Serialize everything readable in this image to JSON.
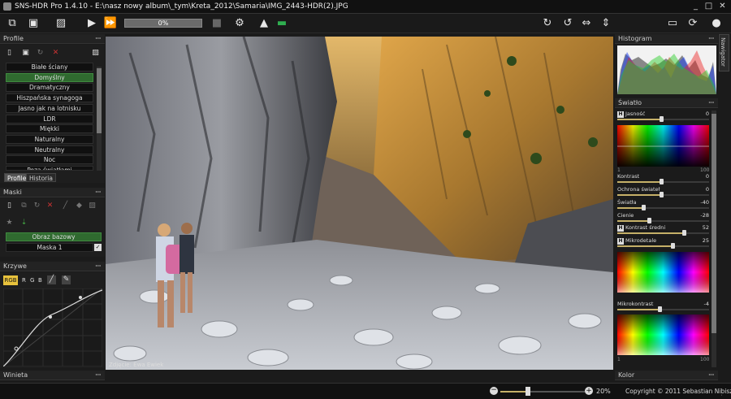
{
  "window": {
    "title": "SNS-HDR Pro 1.4.10 - E:\\nasz nowy album\\_tym\\Kreta_2012\\Samaria\\IMG_2443-HDR(2).JPG"
  },
  "toolbar": {
    "progress": "0%"
  },
  "profile": {
    "title": "Profile",
    "presets": [
      "Białe ściany",
      "Domyślny",
      "Dramatyczny",
      "Hiszpańska synagoga",
      "Jasno jak na lotnisku",
      "LDR",
      "Miękki",
      "Naturalny",
      "Neutralny",
      "Noc",
      "Poza światłami"
    ],
    "selected_index": 1,
    "tabs": [
      "Profile",
      "Historia"
    ]
  },
  "maski": {
    "title": "Maski",
    "items": [
      "Obraz bazowy",
      "Maska 1"
    ]
  },
  "krzywe": {
    "title": "Krzywe",
    "channels": [
      "RGB",
      "R",
      "G",
      "B"
    ]
  },
  "winieta": {
    "title": "Winieta"
  },
  "histogram": {
    "title": "Histogram",
    "side_tab": "Nawigator"
  },
  "swiatlo": {
    "title": "Światło",
    "sliders": [
      {
        "label": "Jasność",
        "value": "0",
        "h": true
      },
      {
        "label": "Kontrast",
        "value": "0"
      },
      {
        "label": "Ochrona świateł",
        "value": "0"
      },
      {
        "label": "Światła",
        "value": "-40"
      },
      {
        "label": "Cienie",
        "value": "-28"
      },
      {
        "label": "Kontrast średni",
        "value": "52",
        "h": true
      },
      {
        "label": "Mikrodetale",
        "value": "25",
        "h": true
      },
      {
        "label": "Mikrokontrast",
        "value": "-4"
      }
    ],
    "gradient_scale": [
      "1",
      "100"
    ]
  },
  "kolor": {
    "title": "Kolor"
  },
  "photo": {
    "watermark": "Zdjęcie: Ewa Ewiek"
  },
  "status": {
    "zoom": "20%",
    "copyright": "Copyright © 2011 Sebastian Nibisz"
  }
}
